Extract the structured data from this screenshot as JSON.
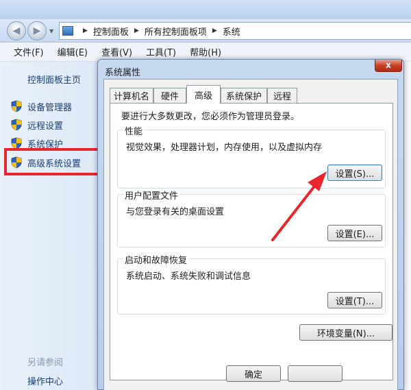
{
  "window": {
    "breadcrumbs": [
      "控制面板",
      "所有控制面板项",
      "系统"
    ]
  },
  "menubar": {
    "items": [
      "文件(F)",
      "编辑(E)",
      "查看(V)",
      "工具(T)",
      "帮助(H)"
    ]
  },
  "sidebar": {
    "home_link": "控制面板主页",
    "tasks": [
      {
        "label": "设备管理器",
        "icon": "shield-icon"
      },
      {
        "label": "远程设置",
        "icon": "shield-icon"
      },
      {
        "label": "系统保护",
        "icon": "shield-icon"
      },
      {
        "label": "高级系统设置",
        "icon": "shield-icon",
        "highlighted": true
      }
    ],
    "see_also": "另请参阅",
    "action_center": "操作中心"
  },
  "dialog": {
    "title": "系统属性",
    "close_label": "x",
    "tabs": [
      "计算机名",
      "硬件",
      "高级",
      "系统保护",
      "远程"
    ],
    "active_tab": "高级",
    "admin_note": "要进行大多数更改，您必须作为管理员登录。",
    "performance": {
      "title": "性能",
      "description": "视觉效果，处理器计划，内存使用，以及虚拟内存",
      "button": "设置(S)..."
    },
    "user_profiles": {
      "title": "用户配置文件",
      "description": "与您登录有关的桌面设置",
      "button": "设置(E)..."
    },
    "startup_recovery": {
      "title": "启动和故障恢复",
      "description": "系统启动、系统失败和调试信息",
      "button": "设置(T)..."
    },
    "env_button": "环境变量(N)...",
    "ok_button": "确定"
  },
  "colors": {
    "highlight_red": "#e8262c",
    "link_blue": "#1a3e72"
  }
}
